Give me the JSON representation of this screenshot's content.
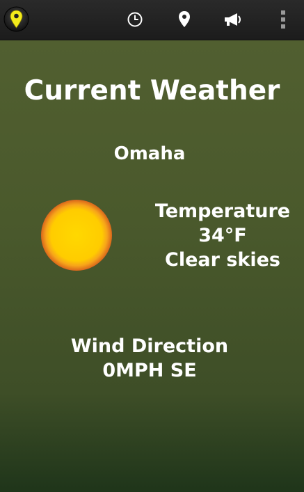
{
  "actionbar": {
    "app_icon": "map-pin-icon",
    "actions": [
      {
        "icon": "clock-icon"
      },
      {
        "icon": "location-pin-icon"
      },
      {
        "icon": "megaphone-icon"
      },
      {
        "icon": "overflow-menu-icon"
      }
    ]
  },
  "weather": {
    "title": "Current Weather",
    "city": "Omaha",
    "temperature_label": "Temperature",
    "temperature_value": "34°F",
    "condition": "Clear skies",
    "condition_icon": "sun-icon",
    "wind_label": "Wind Direction",
    "wind_value": "0MPH SE"
  },
  "colors": {
    "background_top": "#515f30",
    "background_bottom": "#1f351a",
    "action_bar": "#222222",
    "sun_core": "#ffd400",
    "sun_rim": "#e0701a",
    "text": "#ffffff"
  }
}
